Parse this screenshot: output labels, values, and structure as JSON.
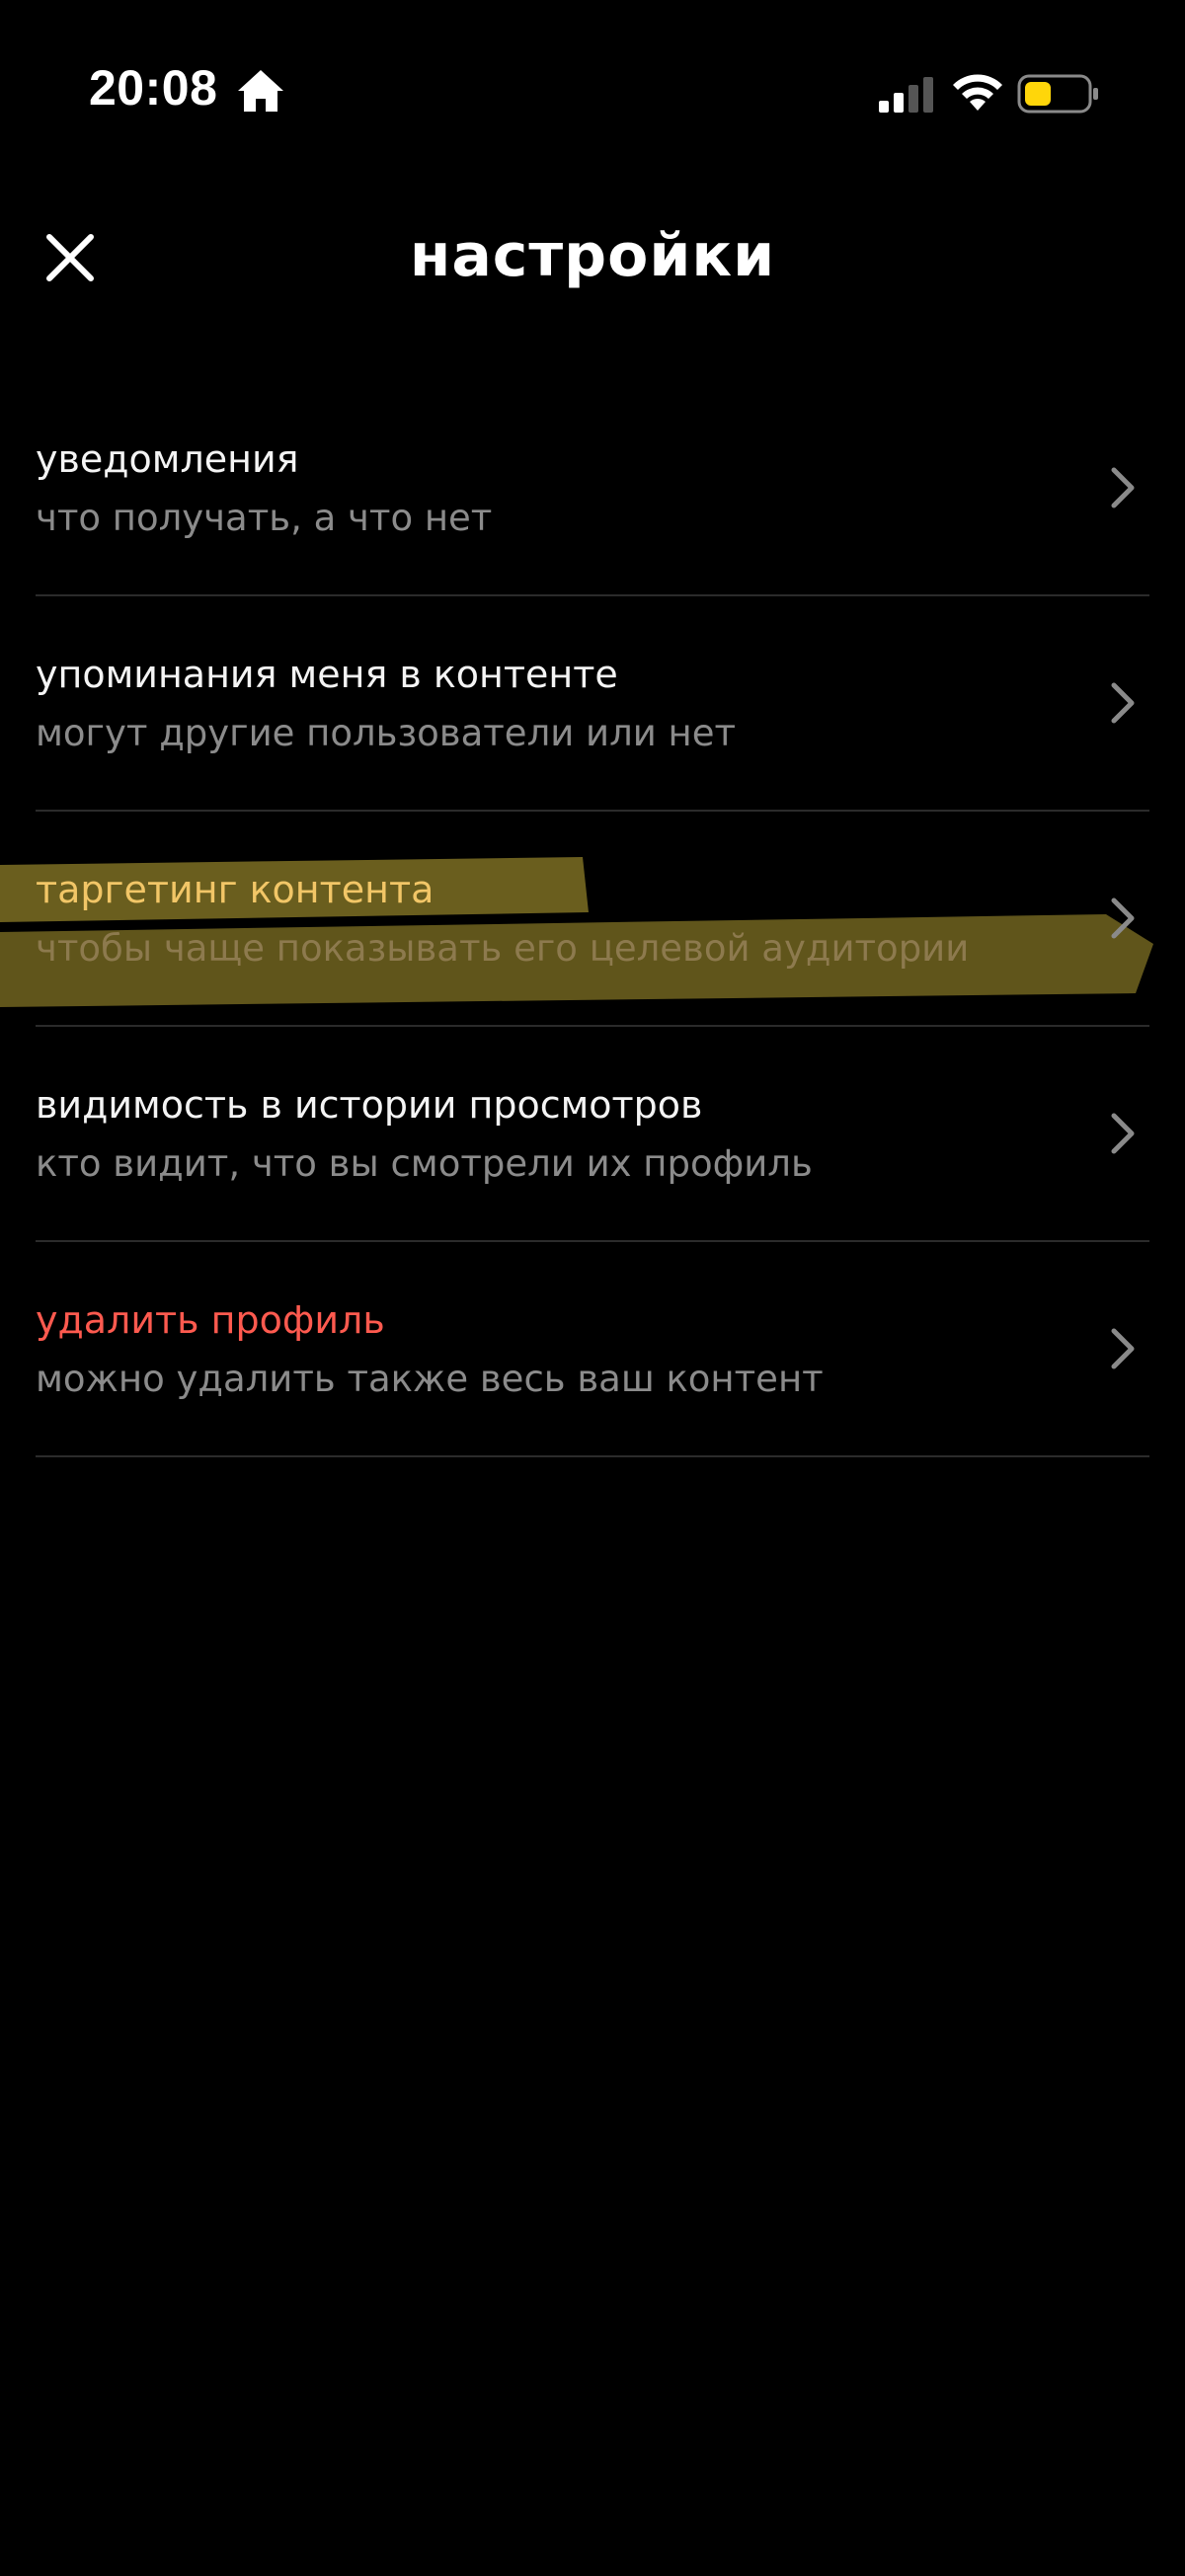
{
  "status_bar": {
    "time": "20:08"
  },
  "header": {
    "title": "настройки"
  },
  "settings": {
    "items": [
      {
        "title": "уведомления",
        "subtitle": "что получать, а что нет"
      },
      {
        "title": "упоминания меня в контенте",
        "subtitle": "могут другие пользователи или нет"
      },
      {
        "title": "таргетинг контента",
        "subtitle": "чтобы чаще показывать его целевой аудитории"
      },
      {
        "title": "видимость в истории просмотров",
        "subtitle": "кто видит, что вы смотрели их профиль"
      },
      {
        "title": "удалить профиль",
        "subtitle": "можно удалить также весь ваш контент"
      }
    ]
  },
  "colors": {
    "background": "#000000",
    "title_text": "#f4f4f4",
    "subtitle_text": "#8b8b8b",
    "highlight_title": "#f2c667",
    "danger": "#ff5a4f",
    "marker_highlight": "#fde047",
    "divider": "#2b2b2b",
    "battery_fill": "#ffd60a"
  },
  "icons": {
    "home": "home-icon",
    "signal": "cellular-signal-icon",
    "wifi": "wifi-icon",
    "battery": "battery-icon",
    "close": "close-icon",
    "chevron": "chevron-right-icon"
  }
}
